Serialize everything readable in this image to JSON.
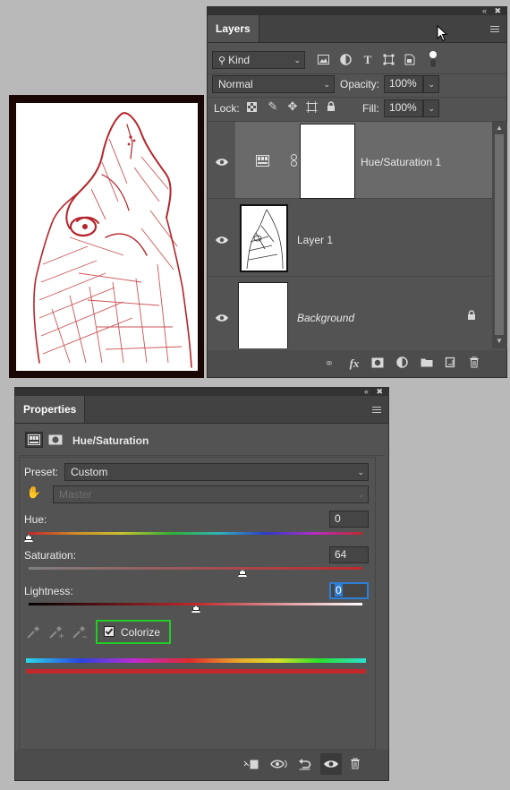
{
  "layers_panel": {
    "tab_label": "Layers",
    "filter_kind": "Kind",
    "blend_mode": "Normal",
    "opacity_label": "Opacity:",
    "opacity_value": "100%",
    "lock_label": "Lock:",
    "fill_label": "Fill:",
    "fill_value": "100%",
    "layers": [
      {
        "name": "Hue/Saturation 1",
        "type": "adjustment",
        "selected": true,
        "visible": true
      },
      {
        "name": "Layer 1",
        "type": "image",
        "selected": false,
        "visible": true
      },
      {
        "name": "Background",
        "type": "background",
        "selected": false,
        "visible": true,
        "locked": true
      }
    ],
    "footer_icons": [
      "link-icon",
      "fx-icon",
      "add-mask-icon",
      "adjustment-icon",
      "folder-icon",
      "new-layer-icon",
      "trash-icon"
    ],
    "fx_label": "fx"
  },
  "properties_panel": {
    "tab_label": "Properties",
    "title": "Hue/Saturation",
    "preset_label": "Preset:",
    "preset_value": "Custom",
    "channel_value": "Master",
    "hue_label": "Hue:",
    "hue_value": "0",
    "saturation_label": "Saturation:",
    "saturation_value": "64",
    "lightness_label": "Lightness:",
    "lightness_value": "0",
    "colorize_label": "Colorize",
    "colorize_checked": true,
    "slider_levels": {
      "hue": 0.0,
      "saturation": 0.64,
      "lightness": 0.5
    }
  },
  "colors": {
    "panel_bg": "#535353",
    "selected_layer": "#6a6a6a",
    "colorize_highlight": "#22cc22",
    "colorize_tint": "#c0282c",
    "canvas_bg": "#b9b9b9"
  }
}
